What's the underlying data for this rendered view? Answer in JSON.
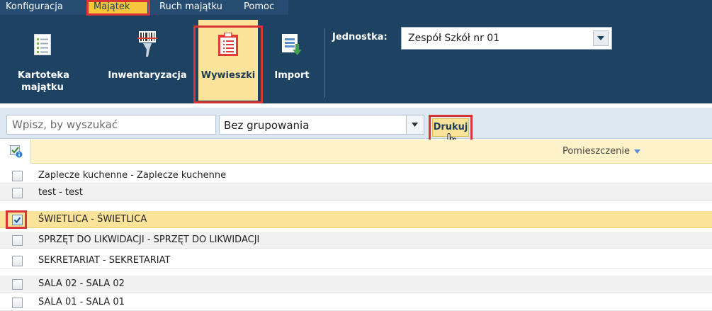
{
  "menu": {
    "tabs": [
      "Konfiguracja",
      "Majątek",
      "Ruch majątku",
      "Pomoc"
    ],
    "active": "Majątek"
  },
  "ribbon": {
    "tools": [
      {
        "label": "Kartoteka majątku",
        "icon": "asset-card-icon"
      },
      {
        "label": "Inwentaryzacja",
        "icon": "barcode-scanner-icon"
      },
      {
        "label": "Wywieszki",
        "icon": "clipboard-list-icon"
      },
      {
        "label": "Import",
        "icon": "spreadsheet-import-icon"
      }
    ],
    "active_tool": "Wywieszki",
    "unit_label": "Jednostka:",
    "unit_value": "Zespół Szkół nr 01"
  },
  "toolbar": {
    "search_placeholder": "Wpisz, by wyszukać",
    "grouping_value": "Bez grupowania",
    "print_label": "Drukuj"
  },
  "table": {
    "column_header": "Pomieszczenie",
    "sort": "descending",
    "rows": [
      {
        "label": "Zaplecze kuchenne - Zaplecze kuchenne",
        "checked": false
      },
      {
        "label": "test - test",
        "checked": false
      },
      {
        "label": "ŚWIETLICA - ŚWIETLICA",
        "checked": true
      },
      {
        "label": "SPRZĘT DO LIKWIDACJI - SPRZĘT DO LIKWIDACJI",
        "checked": false
      },
      {
        "label": "SEKRETARIAT - SEKRETARIAT",
        "checked": false
      },
      {
        "label": "SALA 02 - SALA 02",
        "checked": false
      },
      {
        "label": "SALA 01 - SALA 01",
        "checked": false
      }
    ]
  },
  "colors": {
    "ribbon_bg": "#1d4262",
    "accent_yellow": "#f6c63c",
    "highlight_red": "#d93434",
    "selected_row": "#fbe39a"
  }
}
